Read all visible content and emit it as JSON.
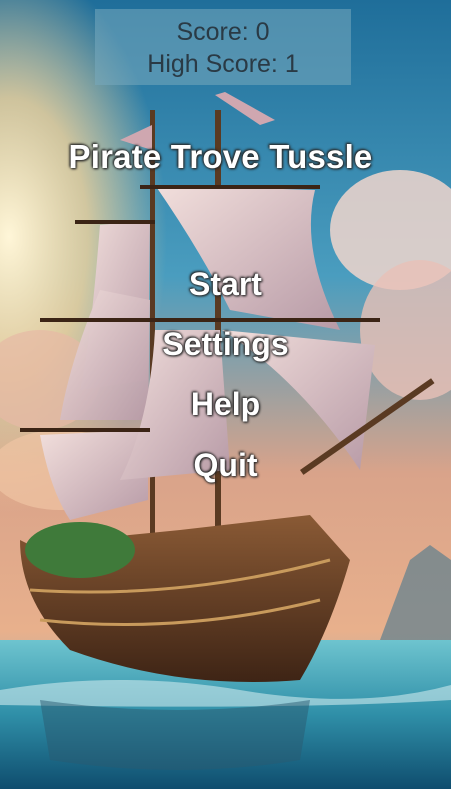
{
  "score": {
    "score_text": "Score: 0",
    "high_score_text": "High Score: 1"
  },
  "title": "Pirate Trove Tussle",
  "menu": {
    "items": [
      {
        "label": "Start"
      },
      {
        "label": "Settings"
      },
      {
        "label": "Help"
      },
      {
        "label": "Quit"
      }
    ]
  }
}
